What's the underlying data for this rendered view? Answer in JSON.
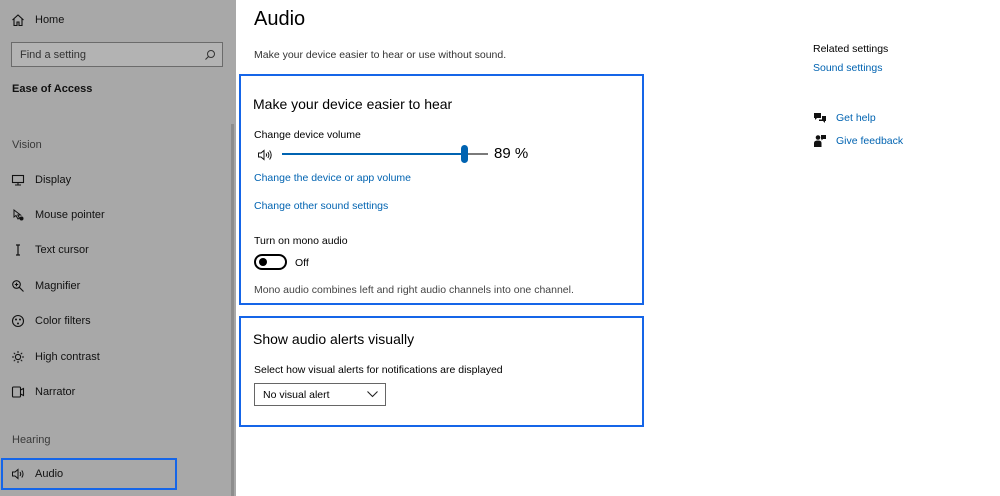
{
  "sidebar": {
    "home_label": "Home",
    "search_placeholder": "Find a setting",
    "section_title": "Ease of Access",
    "group_vision": "Vision",
    "group_hearing": "Hearing",
    "items": [
      {
        "label": "Display",
        "icon": "display-icon"
      },
      {
        "label": "Mouse pointer",
        "icon": "mouse-pointer-icon"
      },
      {
        "label": "Text cursor",
        "icon": "text-cursor-icon"
      },
      {
        "label": "Magnifier",
        "icon": "magnifier-icon"
      },
      {
        "label": "Color filters",
        "icon": "color-filters-icon"
      },
      {
        "label": "High contrast",
        "icon": "high-contrast-icon"
      },
      {
        "label": "Narrator",
        "icon": "narrator-icon"
      }
    ],
    "audio_label": "Audio"
  },
  "main": {
    "title": "Audio",
    "subtitle": "Make your device easier to hear or use without sound.",
    "hear_panel": {
      "title": "Make your device easier to hear",
      "volume_label": "Change device volume",
      "volume_value": 89,
      "volume_text": "89 %",
      "link_app_volume": "Change the device or app volume",
      "link_other_sound": "Change other sound settings",
      "mono_label": "Turn on mono audio",
      "mono_state": "Off",
      "mono_description": "Mono audio combines left and right audio channels into one channel."
    },
    "alerts_panel": {
      "title": "Show audio alerts visually",
      "select_label": "Select how visual alerts for notifications are displayed",
      "select_value": "No visual alert"
    }
  },
  "related": {
    "heading": "Related settings",
    "sound_settings_link": "Sound settings",
    "get_help": "Get help",
    "give_feedback": "Give feedback"
  },
  "colors": {
    "accent": "#0063b1",
    "highlight_border": "#1565e8",
    "sidebar_bg": "#a8a8a8"
  }
}
